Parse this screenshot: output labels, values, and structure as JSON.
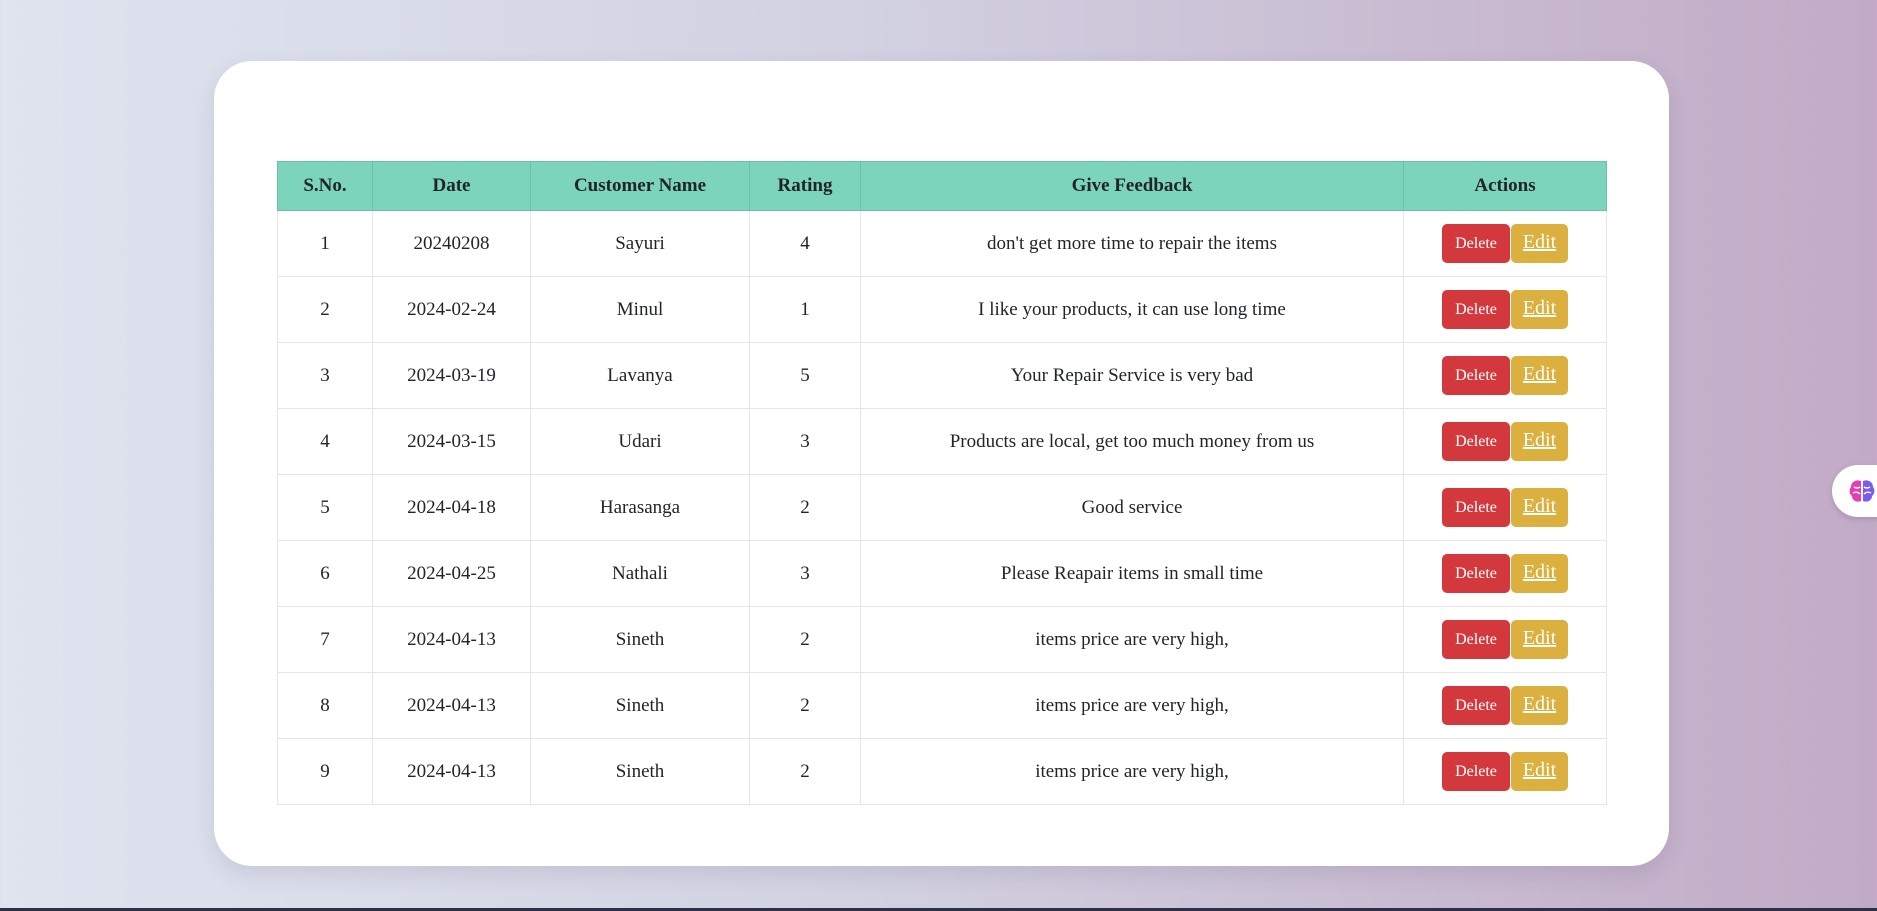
{
  "table": {
    "headers": [
      "S.No.",
      "Date",
      "Customer Name",
      "Rating",
      "Give Feedback",
      "Actions"
    ],
    "rows": [
      {
        "sno": "1",
        "date": "20240208",
        "name": "Sayuri",
        "rating": "4",
        "feedback": "don't get more time to repair the items"
      },
      {
        "sno": "2",
        "date": "2024-02-24",
        "name": "Minul",
        "rating": "1",
        "feedback": "I like your products, it can use long time"
      },
      {
        "sno": "3",
        "date": "2024-03-19",
        "name": "Lavanya",
        "rating": "5",
        "feedback": "Your Repair Service is very bad"
      },
      {
        "sno": "4",
        "date": "2024-03-15",
        "name": "Udari",
        "rating": "3",
        "feedback": "Products are local, get too much money from us"
      },
      {
        "sno": "5",
        "date": "2024-04-18",
        "name": "Harasanga",
        "rating": "2",
        "feedback": "Good service"
      },
      {
        "sno": "6",
        "date": "2024-04-25",
        "name": "Nathali",
        "rating": "3",
        "feedback": "Please Reapair items in small time"
      },
      {
        "sno": "7",
        "date": "2024-04-13",
        "name": "Sineth",
        "rating": "2",
        "feedback": "items price are very high,"
      },
      {
        "sno": "8",
        "date": "2024-04-13",
        "name": "Sineth",
        "rating": "2",
        "feedback": "items price are very high,"
      },
      {
        "sno": "9",
        "date": "2024-04-13",
        "name": "Sineth",
        "rating": "2",
        "feedback": "items price are very high,"
      }
    ]
  },
  "actions": {
    "delete_label": "Delete",
    "edit_label": "Edit"
  },
  "colors": {
    "header_bg": "#7dd4bd",
    "delete_button": "#d3383d",
    "edit_button": "#dbb03f"
  },
  "icons": {
    "floating_assistant": "brain-icon"
  }
}
